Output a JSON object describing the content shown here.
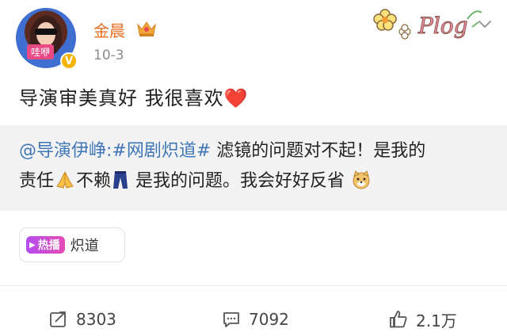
{
  "header": {
    "username": "金晨",
    "timestamp": "10-3",
    "avatar_tag": "哇咿",
    "verified_badge": "V",
    "crown_icon": "vip-crown-icon",
    "sticker_text": "Plog"
  },
  "post": {
    "text": "导演审美真好  我很喜欢",
    "emoji": "❤️"
  },
  "repost": {
    "mention": "@导演伊峥",
    "hashtag": ":#网剧炽道#",
    "line1": " 滤镜的问题对不起！是我的",
    "line2a": "责任",
    "line2b": "不赖",
    "line2c": " 是我的问题。我会好好反省"
  },
  "topic": {
    "badge": "热播",
    "label": "炽道"
  },
  "actions": {
    "repost_count": "8303",
    "comment_count": "7092",
    "like_count": "2.1万"
  },
  "colors": {
    "username": "#e86b1c",
    "mention": "#3f76b8",
    "repost_bg": "#f3f3f3"
  }
}
